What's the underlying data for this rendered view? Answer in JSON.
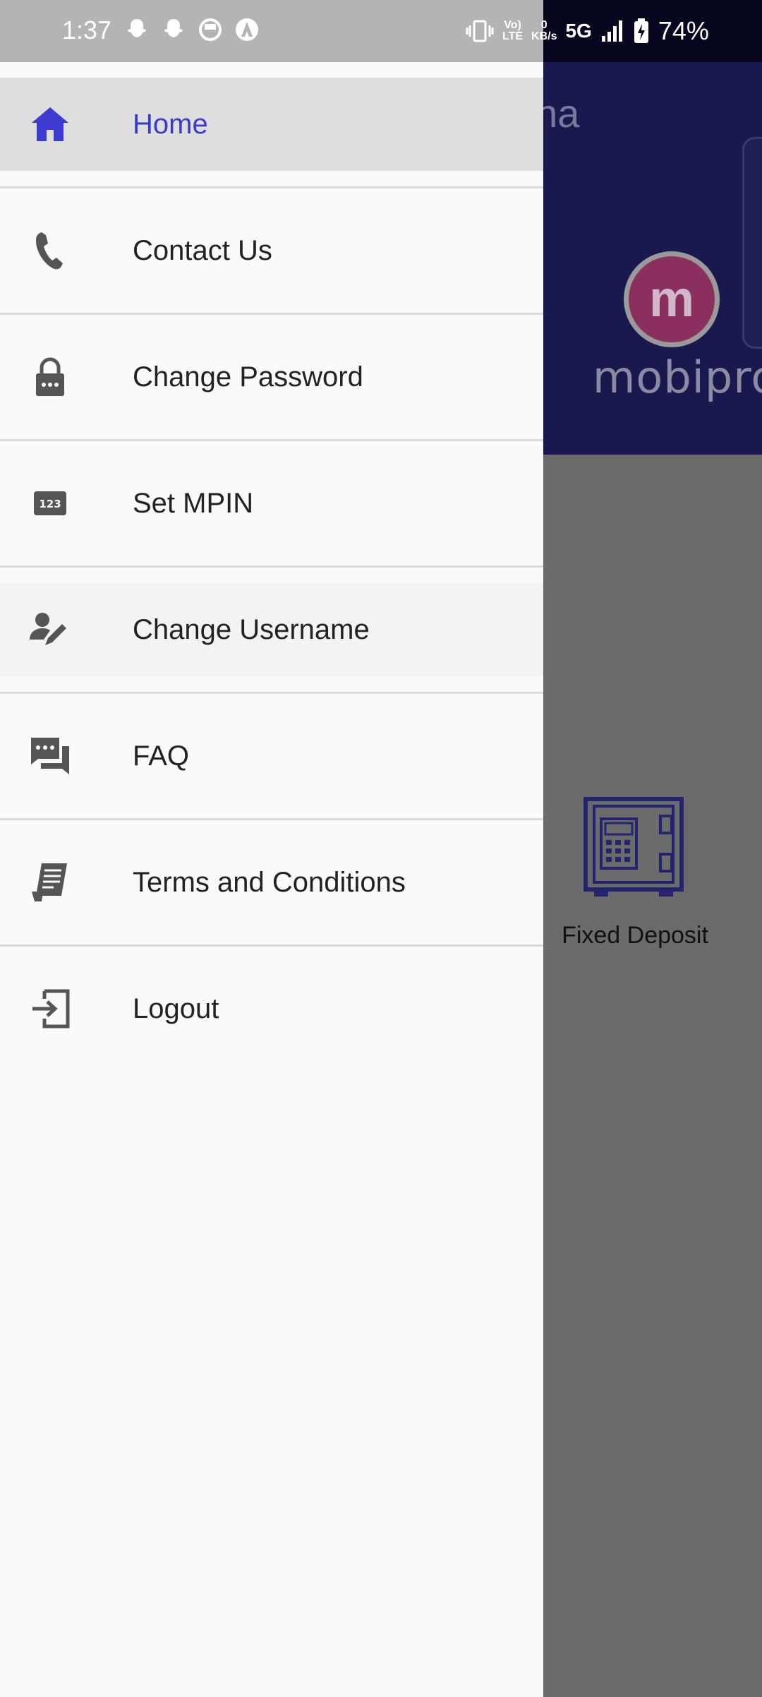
{
  "status_bar": {
    "time": "1:37",
    "net_speed_value": "0",
    "net_speed_unit": "KB/s",
    "volte_line1": "Vo)",
    "volte_line2": "LTE",
    "network": "5G",
    "battery": "74%"
  },
  "background_app": {
    "title_partial": "sana",
    "logo_letter": "m",
    "logo_text": "mobipro",
    "fixed_deposit_label": "Fixed Deposit"
  },
  "drawer": {
    "items": [
      {
        "label": "Home",
        "icon": "home-icon",
        "active": true
      },
      {
        "label": "Contact Us",
        "icon": "phone-icon"
      },
      {
        "label": "Change Password",
        "icon": "lock-icon"
      },
      {
        "label": "Set MPIN",
        "icon": "pin-123-icon"
      },
      {
        "label": "Change Username",
        "icon": "edit-user-icon"
      },
      {
        "label": "FAQ",
        "icon": "chat-bubbles-icon"
      },
      {
        "label": "Terms and Conditions",
        "icon": "document-icon"
      },
      {
        "label": "Logout",
        "icon": "logout-icon"
      }
    ]
  },
  "colors": {
    "active_label": "#3b3bc4",
    "active_icon": "#3b3bd0",
    "header_bg": "#19194f",
    "scrim": "#6b6b6b"
  }
}
